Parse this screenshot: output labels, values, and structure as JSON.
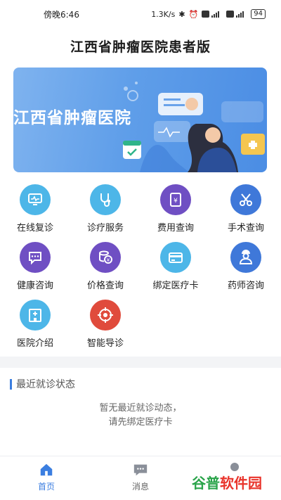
{
  "status_bar": {
    "time": "傍晚6:46",
    "speed": "1.3K/s",
    "battery": "94",
    "icons": [
      "bluetooth-icon",
      "alarm-icon",
      "hd-icon",
      "signal-4g-icon",
      "hd-icon",
      "signal-4g-icon"
    ]
  },
  "app": {
    "title": "江西省肿瘤医院患者版"
  },
  "banner": {
    "text": "江西省肿瘤医院"
  },
  "services": [
    {
      "label": "在线复诊",
      "icon": "monitor-icon",
      "color": "#4db6e8"
    },
    {
      "label": "诊疗服务",
      "icon": "stethoscope-icon",
      "color": "#4db6e8"
    },
    {
      "label": "费用查询",
      "icon": "bill-icon",
      "color": "#6f4fc3"
    },
    {
      "label": "手术查询",
      "icon": "scissors-icon",
      "color": "#3f78d9"
    },
    {
      "label": "健康咨询",
      "icon": "chat-bubble-icon",
      "color": "#6f4fc3"
    },
    {
      "label": "价格查询",
      "icon": "price-icon",
      "color": "#6f4fc3"
    },
    {
      "label": "绑定医疗卡",
      "icon": "card-icon",
      "color": "#4db6e8"
    },
    {
      "label": "药师咨询",
      "icon": "pharmacist-icon",
      "color": "#3f78d9"
    },
    {
      "label": "医院介绍",
      "icon": "hospital-icon",
      "color": "#4db6e8"
    },
    {
      "label": "智能导诊",
      "icon": "target-icon",
      "color": "#e04b3c"
    }
  ],
  "recent": {
    "title": "最近就诊状态",
    "empty_line1": "暂无最近就诊动态，",
    "empty_line2": "请先绑定医疗卡"
  },
  "tabs": [
    {
      "label": "首页",
      "icon": "home-icon",
      "active": true
    },
    {
      "label": "消息",
      "icon": "message-icon",
      "active": false
    }
  ],
  "watermark": {
    "part1": "谷普",
    "part2": "软件园"
  },
  "colors": {
    "accent": "#3b7ee0",
    "banner": "#5f9ee9"
  }
}
